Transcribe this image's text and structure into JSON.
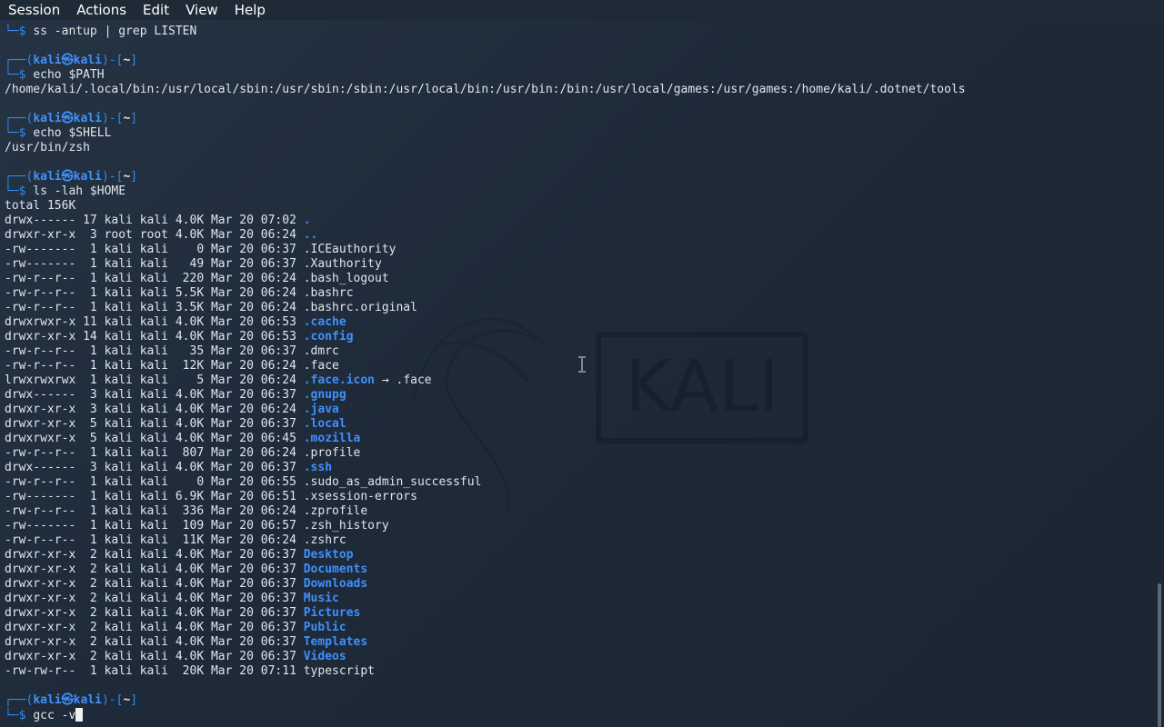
{
  "menu": [
    "Session",
    "Actions",
    "Edit",
    "View",
    "Help"
  ],
  "watermark": "KALI",
  "prompt": {
    "user": "kali",
    "at_symbol": "㉿",
    "host": "kali",
    "path": "~"
  },
  "blocks": [
    {
      "command": "ss -antup | grep LISTEN",
      "output": [],
      "first_partial": true
    },
    {
      "command": "echo $PATH",
      "output": [
        "/home/kali/.local/bin:/usr/local/sbin:/usr/sbin:/sbin:/usr/local/bin:/usr/bin:/bin:/usr/local/games:/usr/games:/home/kali/.dotnet/tools"
      ]
    },
    {
      "command": "echo $SHELL",
      "output": [
        "/usr/bin/zsh"
      ]
    },
    {
      "command": "ls -lah $HOME",
      "output": []
    },
    {
      "command": "gcc -v",
      "output": [],
      "current": true
    }
  ],
  "listing": {
    "total": "total 156K",
    "rows": [
      {
        "perm": "drwx------",
        "links": "17",
        "owner": "kali",
        "group": "kali",
        "size": "4.0K",
        "date": "Mar 20 07:02",
        "name": ".",
        "type": "dir"
      },
      {
        "perm": "drwxr-xr-x",
        "links": "3",
        "owner": "root",
        "group": "root",
        "size": "4.0K",
        "date": "Mar 20 06:24",
        "name": "..",
        "type": "dir"
      },
      {
        "perm": "-rw-------",
        "links": "1",
        "owner": "kali",
        "group": "kali",
        "size": "0",
        "date": "Mar 20 06:37",
        "name": ".ICEauthority",
        "type": "file"
      },
      {
        "perm": "-rw-------",
        "links": "1",
        "owner": "kali",
        "group": "kali",
        "size": "49",
        "date": "Mar 20 06:37",
        "name": ".Xauthority",
        "type": "file"
      },
      {
        "perm": "-rw-r--r--",
        "links": "1",
        "owner": "kali",
        "group": "kali",
        "size": "220",
        "date": "Mar 20 06:24",
        "name": ".bash_logout",
        "type": "file"
      },
      {
        "perm": "-rw-r--r--",
        "links": "1",
        "owner": "kali",
        "group": "kali",
        "size": "5.5K",
        "date": "Mar 20 06:24",
        "name": ".bashrc",
        "type": "file"
      },
      {
        "perm": "-rw-r--r--",
        "links": "1",
        "owner": "kali",
        "group": "kali",
        "size": "3.5K",
        "date": "Mar 20 06:24",
        "name": ".bashrc.original",
        "type": "file"
      },
      {
        "perm": "drwxrwxr-x",
        "links": "11",
        "owner": "kali",
        "group": "kali",
        "size": "4.0K",
        "date": "Mar 20 06:53",
        "name": ".cache",
        "type": "dir"
      },
      {
        "perm": "drwxr-xr-x",
        "links": "14",
        "owner": "kali",
        "group": "kali",
        "size": "4.0K",
        "date": "Mar 20 06:53",
        "name": ".config",
        "type": "dir"
      },
      {
        "perm": "-rw-r--r--",
        "links": "1",
        "owner": "kali",
        "group": "kali",
        "size": "35",
        "date": "Mar 20 06:37",
        "name": ".dmrc",
        "type": "file"
      },
      {
        "perm": "-rw-r--r--",
        "links": "1",
        "owner": "kali",
        "group": "kali",
        "size": "12K",
        "date": "Mar 20 06:24",
        "name": ".face",
        "type": "file"
      },
      {
        "perm": "lrwxrwxrwx",
        "links": "1",
        "owner": "kali",
        "group": "kali",
        "size": "5",
        "date": "Mar 20 06:24",
        "name": ".face.icon",
        "type": "link",
        "target": ".face",
        "arrow": "→"
      },
      {
        "perm": "drwx------",
        "links": "3",
        "owner": "kali",
        "group": "kali",
        "size": "4.0K",
        "date": "Mar 20 06:37",
        "name": ".gnupg",
        "type": "dir"
      },
      {
        "perm": "drwxr-xr-x",
        "links": "3",
        "owner": "kali",
        "group": "kali",
        "size": "4.0K",
        "date": "Mar 20 06:24",
        "name": ".java",
        "type": "dir"
      },
      {
        "perm": "drwxr-xr-x",
        "links": "5",
        "owner": "kali",
        "group": "kali",
        "size": "4.0K",
        "date": "Mar 20 06:37",
        "name": ".local",
        "type": "dir"
      },
      {
        "perm": "drwxrwxr-x",
        "links": "5",
        "owner": "kali",
        "group": "kali",
        "size": "4.0K",
        "date": "Mar 20 06:45",
        "name": ".mozilla",
        "type": "dir"
      },
      {
        "perm": "-rw-r--r--",
        "links": "1",
        "owner": "kali",
        "group": "kali",
        "size": "807",
        "date": "Mar 20 06:24",
        "name": ".profile",
        "type": "file"
      },
      {
        "perm": "drwx------",
        "links": "3",
        "owner": "kali",
        "group": "kali",
        "size": "4.0K",
        "date": "Mar 20 06:37",
        "name": ".ssh",
        "type": "dir"
      },
      {
        "perm": "-rw-r--r--",
        "links": "1",
        "owner": "kali",
        "group": "kali",
        "size": "0",
        "date": "Mar 20 06:55",
        "name": ".sudo_as_admin_successful",
        "type": "file"
      },
      {
        "perm": "-rw-------",
        "links": "1",
        "owner": "kali",
        "group": "kali",
        "size": "6.9K",
        "date": "Mar 20 06:51",
        "name": ".xsession-errors",
        "type": "file"
      },
      {
        "perm": "-rw-r--r--",
        "links": "1",
        "owner": "kali",
        "group": "kali",
        "size": "336",
        "date": "Mar 20 06:24",
        "name": ".zprofile",
        "type": "file"
      },
      {
        "perm": "-rw-------",
        "links": "1",
        "owner": "kali",
        "group": "kali",
        "size": "109",
        "date": "Mar 20 06:57",
        "name": ".zsh_history",
        "type": "file"
      },
      {
        "perm": "-rw-r--r--",
        "links": "1",
        "owner": "kali",
        "group": "kali",
        "size": "11K",
        "date": "Mar 20 06:24",
        "name": ".zshrc",
        "type": "file"
      },
      {
        "perm": "drwxr-xr-x",
        "links": "2",
        "owner": "kali",
        "group": "kali",
        "size": "4.0K",
        "date": "Mar 20 06:37",
        "name": "Desktop",
        "type": "dir"
      },
      {
        "perm": "drwxr-xr-x",
        "links": "2",
        "owner": "kali",
        "group": "kali",
        "size": "4.0K",
        "date": "Mar 20 06:37",
        "name": "Documents",
        "type": "dir"
      },
      {
        "perm": "drwxr-xr-x",
        "links": "2",
        "owner": "kali",
        "group": "kali",
        "size": "4.0K",
        "date": "Mar 20 06:37",
        "name": "Downloads",
        "type": "dir"
      },
      {
        "perm": "drwxr-xr-x",
        "links": "2",
        "owner": "kali",
        "group": "kali",
        "size": "4.0K",
        "date": "Mar 20 06:37",
        "name": "Music",
        "type": "dir"
      },
      {
        "perm": "drwxr-xr-x",
        "links": "2",
        "owner": "kali",
        "group": "kali",
        "size": "4.0K",
        "date": "Mar 20 06:37",
        "name": "Pictures",
        "type": "dir"
      },
      {
        "perm": "drwxr-xr-x",
        "links": "2",
        "owner": "kali",
        "group": "kali",
        "size": "4.0K",
        "date": "Mar 20 06:37",
        "name": "Public",
        "type": "dir"
      },
      {
        "perm": "drwxr-xr-x",
        "links": "2",
        "owner": "kali",
        "group": "kali",
        "size": "4.0K",
        "date": "Mar 20 06:37",
        "name": "Templates",
        "type": "dir"
      },
      {
        "perm": "drwxr-xr-x",
        "links": "2",
        "owner": "kali",
        "group": "kali",
        "size": "4.0K",
        "date": "Mar 20 06:37",
        "name": "Videos",
        "type": "dir"
      },
      {
        "perm": "-rw-rw-r--",
        "links": "1",
        "owner": "kali",
        "group": "kali",
        "size": "20K",
        "date": "Mar 20 07:11",
        "name": "typescript",
        "type": "file"
      }
    ]
  },
  "colors": {
    "prompt_blue": "#2f8cf0",
    "dir_blue": "#3f8fff",
    "text": "#e1e6ea",
    "menubar_bg": "#1f2a37",
    "background": "#1e2a38"
  }
}
